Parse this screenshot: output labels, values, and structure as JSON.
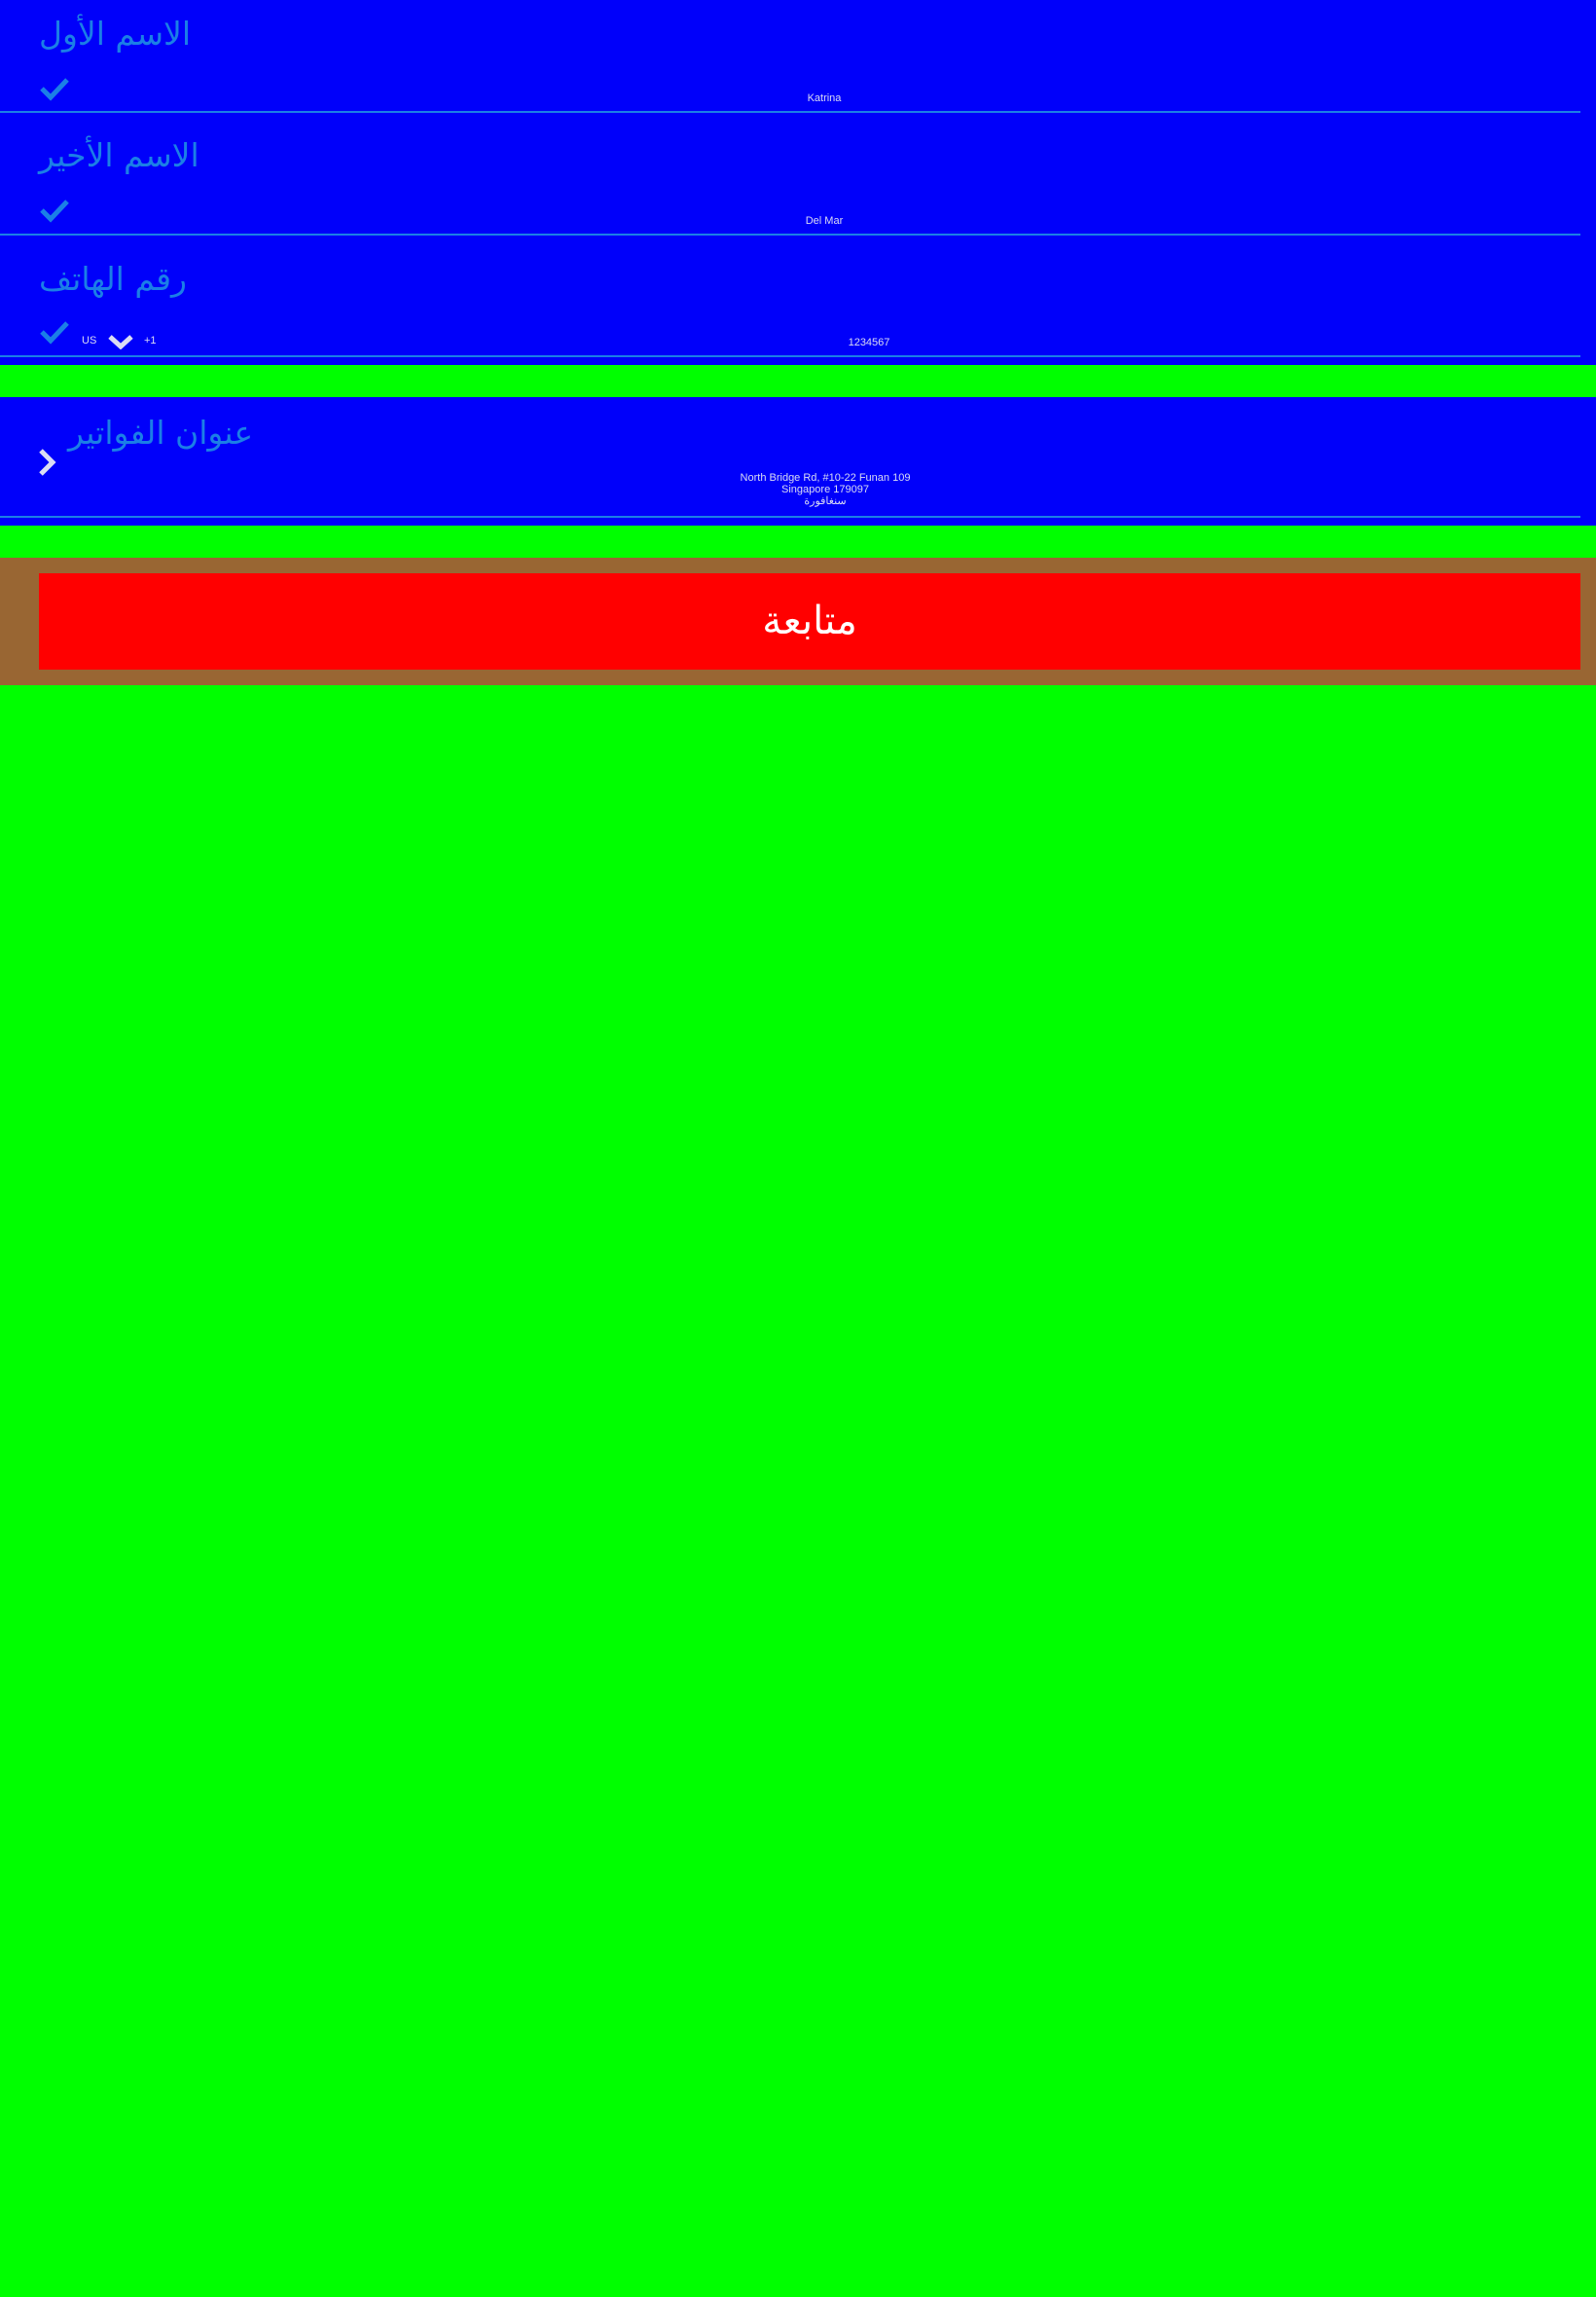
{
  "colors": {
    "page_background": "#00ff00",
    "section_background": "#0000fa",
    "accent": "#1b7fe6",
    "value_text": "#dadcf4",
    "footer_background": "#996633",
    "button_background": "#ff0000",
    "button_text": "#ffffff"
  },
  "contact": {
    "first_name": {
      "label": "الاسم الأول",
      "value": "Katrina",
      "icon": "check-icon"
    },
    "last_name": {
      "label": "الاسم الأخير",
      "value": "Del Mar",
      "icon": "check-icon"
    },
    "phone": {
      "label": "رقم الهاتف",
      "country_code": "US",
      "dial_code": "+1",
      "value": "1234567",
      "icon": "check-icon",
      "dropdown_icon": "chevron-down-icon"
    }
  },
  "billing": {
    "label": "عنوان الفواتير",
    "address_lines": [
      "North Bridge Rd, #10-22 Funan 109",
      "Singapore 179097",
      "سنغافورة"
    ],
    "icon": "chevron-right-icon"
  },
  "footer": {
    "continue_label": "متابعة"
  }
}
